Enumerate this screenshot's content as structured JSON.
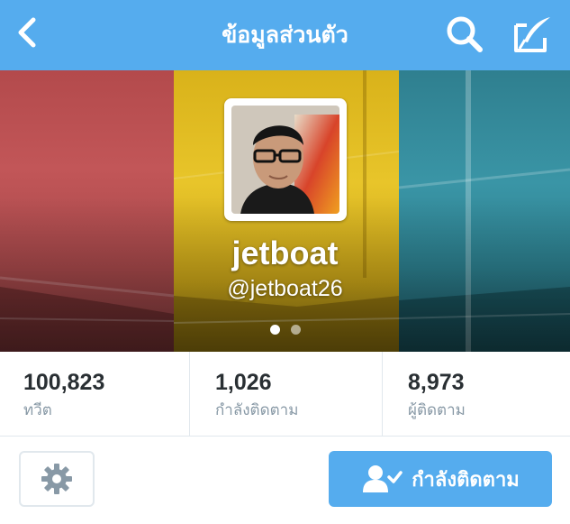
{
  "navbar": {
    "title": "ข้อมูลส่วนตัว",
    "back_icon": "chevron-left-icon",
    "search_icon": "search-icon",
    "compose_icon": "compose-tweet-icon"
  },
  "profile": {
    "display_name": "jetboat",
    "handle": "@jetboat26",
    "pager": {
      "pages": 2,
      "active": 1
    }
  },
  "stats": [
    {
      "value": "100,823",
      "label": "ทวีต"
    },
    {
      "value": "1,026",
      "label": "กำลังติดตาม"
    },
    {
      "value": "8,973",
      "label": "ผู้ติดตาม"
    }
  ],
  "actions": {
    "settings_icon": "gear-icon",
    "following_label": "กำลังติดตาม",
    "following_icon": "person-check-icon"
  },
  "colors": {
    "accent": "#55acee",
    "text_primary": "#292f33",
    "text_secondary": "#8899a6",
    "divider": "#e1e8ed"
  }
}
